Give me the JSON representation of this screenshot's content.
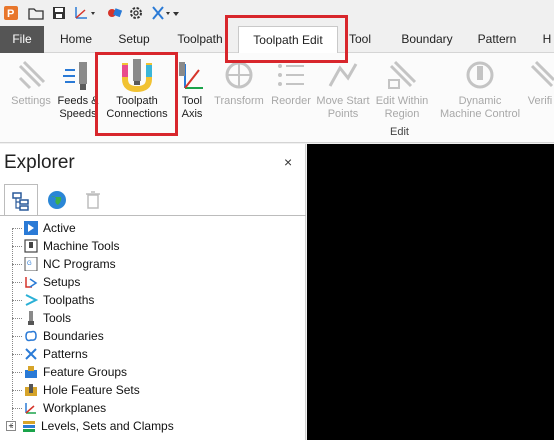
{
  "tabs": {
    "file": "File",
    "home": "Home",
    "setup": "Setup",
    "toolpath": "Toolpath",
    "toolpath_edit": "Toolpath Edit",
    "tool": "Tool",
    "boundary": "Boundary",
    "pattern": "Pattern",
    "more": "H"
  },
  "ribbon": {
    "settings": "Settings",
    "feeds_speeds_1": "Feeds &",
    "feeds_speeds_2": "Speeds",
    "toolpath_connections_1": "Toolpath",
    "toolpath_connections_2": "Connections",
    "tool_axis_1": "Tool",
    "tool_axis_2": "Axis",
    "transform": "Transform",
    "reorder": "Reorder",
    "move_start_1": "Move Start",
    "move_start_2": "Points",
    "edit_within_1": "Edit Within",
    "edit_within_2": "Region",
    "dynamic_1": "Dynamic",
    "dynamic_2": "Machine Control",
    "verify": "Verifi",
    "edit_group": "Edit"
  },
  "explorer": {
    "title": "Explorer",
    "close": "×",
    "items": [
      {
        "label": "Active",
        "icon": "active-icon"
      },
      {
        "label": "Machine Tools",
        "icon": "machine-tools-icon"
      },
      {
        "label": "NC Programs",
        "icon": "nc-programs-icon"
      },
      {
        "label": "Setups",
        "icon": "setups-icon"
      },
      {
        "label": "Toolpaths",
        "icon": "toolpaths-icon"
      },
      {
        "label": "Tools",
        "icon": "tools-icon"
      },
      {
        "label": "Boundaries",
        "icon": "boundaries-icon"
      },
      {
        "label": "Patterns",
        "icon": "patterns-icon"
      },
      {
        "label": "Feature Groups",
        "icon": "feature-groups-icon"
      },
      {
        "label": "Hole Feature Sets",
        "icon": "hole-feature-sets-icon"
      },
      {
        "label": "Workplanes",
        "icon": "workplanes-icon"
      },
      {
        "label": "Levels, Sets and Clamps",
        "icon": "levels-icon"
      }
    ]
  },
  "colors": {
    "highlight": "#d8262c",
    "file_tab": "#555555",
    "viewport": "#000000"
  }
}
